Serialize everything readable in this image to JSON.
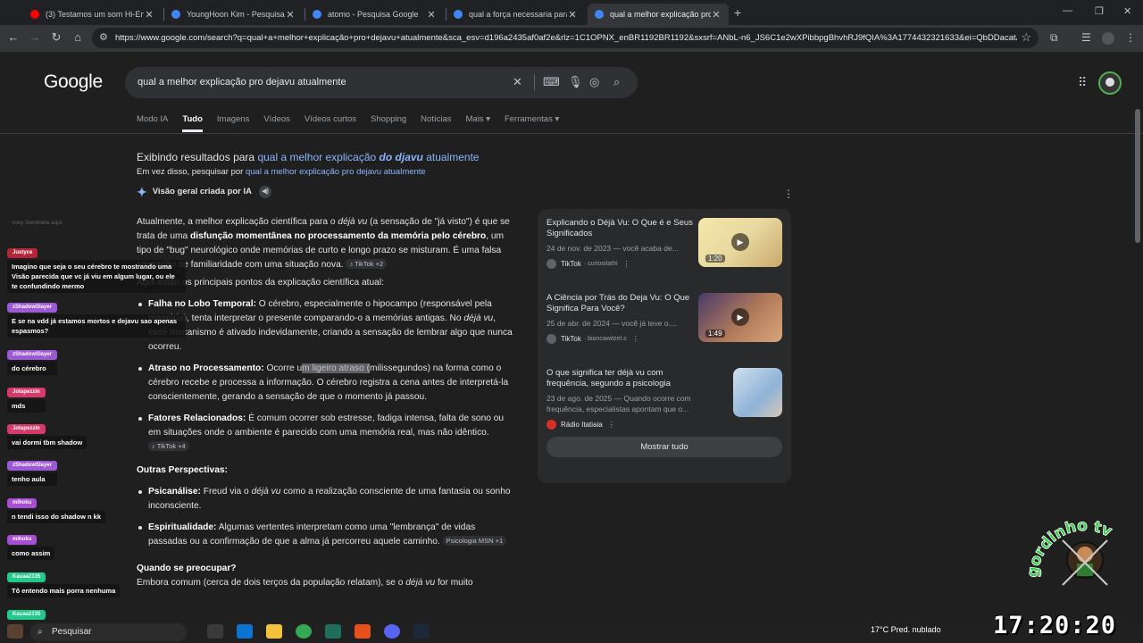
{
  "browser": {
    "tabs": [
      {
        "label": "(3) Testamos um som Hi-End d",
        "color": "#ff0000"
      },
      {
        "label": "YoungHoon Kim - Pesquisa Goo",
        "color": "#4285f4"
      },
      {
        "label": "atomo - Pesquisa Google",
        "color": "#4285f4"
      },
      {
        "label": "qual a força necessaria para 2 a",
        "color": "#4285f4"
      },
      {
        "label": "qual a melhor explicação pro d",
        "color": "#4285f4"
      }
    ],
    "url": "https://www.google.com/search?q=qual+a+melhor+explicação+pro+dejavu+atualmente&sca_esv=d196a2435af0af2e&rlz=1C1OPNX_enBR1192BR1192&sxsrf=ANbL-n6_JS6C1e2wXPibbpgBhvhRJ9fQIA%3A1774432321633&ei=QbDDacatJpbd..."
  },
  "google": {
    "logo": "Google",
    "query": "qual a melhor explicação pro dejavu atualmente",
    "tabs": [
      "Modo IA",
      "Tudo",
      "Imagens",
      "Vídeos",
      "Vídeos curtos",
      "Shopping",
      "Notícias",
      "Mais ▾",
      "Ferramentas ▾"
    ],
    "showing_prefix": "Exibindo resultados para",
    "showing_a": "qual a melhor explicação",
    "showing_b": "do djavu",
    "showing_c": "atualmente",
    "instead_prefix": "Em vez disso, pesquisar por",
    "instead_link": "qual a melhor explicação pro dejavu atualmente",
    "ai_header": "Visão geral criada por IA"
  },
  "ai": {
    "intro_1": "Atualmente, a melhor explicação científica para o",
    "intro_dejavu": "déjà vu",
    "intro_2": "(a sensação de \"já visto\") é que se trata de uma",
    "intro_bold": "disfunção momentânea no processamento da memória pelo cérebro",
    "intro_3": ", um tipo de \"bug\" neurológico onde memórias de curto e longo prazo se misturam. É uma falsa sensação de familiaridade com uma situação nova.",
    "chip1": "♪ TikTok +2",
    "points_intro": "Aqui estão os principais pontos da explicação científica atual:",
    "b1_title": "Falha no Lobo Temporal:",
    "b1_text_a": "O cérebro, especialmente o hipocampo (responsável pela memória), tenta interpretar o presente comparando-o a memórias antigas. No",
    "b1_text_dv": "déjà vu",
    "b1_text_b": ", esse mecanismo é ativado indevidamente, criando a sensação de lembrar algo que nunca ocorreu.",
    "b2_title": "Atraso no Processamento:",
    "b2_text_a": "Ocorre u",
    "b2_hl": "m ligeiro atraso (",
    "b2_text_b": "milissegundos) na forma como o cérebro recebe e processa a informação. O cérebro registra a cena antes de interpretá-la conscientemente, gerando a sensação de que o momento já passou.",
    "b3_title": "Fatores Relacionados:",
    "b3_text": "É comum ocorrer sob estresse, fadiga intensa, falta de sono ou em situações onde o ambiente é parecido com uma memória real, mas não idêntico.",
    "chip2": "♪ TikTok +4",
    "other_title": "Outras Perspectivas:",
    "b4_title": "Psicanálise:",
    "b4_text_a": "Freud via o",
    "b4_text_dv": "déjà vu",
    "b4_text_b": "como a realização consciente de uma fantasia ou sonho inconsciente.",
    "b5_title": "Espiritualidade:",
    "b5_text": "Algumas vertentes interpretam como uma \"lembrança\" de vidas passadas ou a confirmação de que a alma já percorreu aquele caminho.",
    "chip3": "Psicologia MSN +1",
    "worry_title": "Quando se preocupar?",
    "worry_text_a": "Embora comum (cerca de dois terços da população relatam), se o",
    "worry_text_dv": "déjà vu",
    "worry_text_b": "for muito"
  },
  "sources": [
    {
      "title": "Explicando o Déjà Vu: O Que é e Seus Significados",
      "desc": "24 de nov. de 2023 — você acaba de...",
      "site": "TikTok",
      "handle": "· curiositathi",
      "duration": "1:20"
    },
    {
      "title": "A Ciência por Trás do Deja Vu: O Que Significa Para Você?",
      "desc": "25 de abr. de 2024 — você já teve o....",
      "site": "TikTok",
      "handle": "· biancawitzel.s",
      "duration": "1:49"
    },
    {
      "title": "O que significa ter déjà vu com frequência, segundo a psicologia",
      "desc": "23 de ago. de 2025 — Quando ocorre com frequência, especialistas apontam que o...",
      "site": "Rádio Itatiaia",
      "handle": "",
      "duration": ""
    }
  ],
  "show_all": "Mostrar tudo",
  "chat": [
    {
      "user": "Justyce",
      "text": "Imagino que seja o seu cérebro te mostrando uma Visão parecida que vc já viu em algum lugar, ou ele te confundindo mermo",
      "color": "#b3263a"
    },
    {
      "user": "zShadowSlayer",
      "text": "E se na vdd já estamos mortos e dejavu sao apenas espasmos?",
      "color": "#9b59d6"
    },
    {
      "user": "zShadowSlayer",
      "text": "do cérebro",
      "color": "#9b59d6"
    },
    {
      "user": "Jotapezzin",
      "text": "mds",
      "color": "#d63a6a"
    },
    {
      "user": "Jotapezzin",
      "text": "vai dormi tbm shadow",
      "color": "#d63a6a"
    },
    {
      "user": "zShadowSlayer",
      "text": "tenho aula",
      "color": "#9b59d6"
    },
    {
      "user": "mihoku",
      "text": "n tendi isso do shadow n kk",
      "color": "#a64fd6"
    },
    {
      "user": "mihoku",
      "text": "como assim",
      "color": "#a64fd6"
    },
    {
      "user": "Kauaa2135",
      "text": "Tô entendo mais porra nenhuma",
      "color": "#21c98a"
    },
    {
      "user": "Kauaa2135",
      "text": "",
      "color": "#21c98a"
    }
  ],
  "chat_faded": "vovy Sentinela aqui",
  "taskbar": {
    "search": "Pesquisar",
    "weather": "17°C  Pred. nublado",
    "clock": "17:20:20"
  },
  "watermark": "gordinho tv"
}
